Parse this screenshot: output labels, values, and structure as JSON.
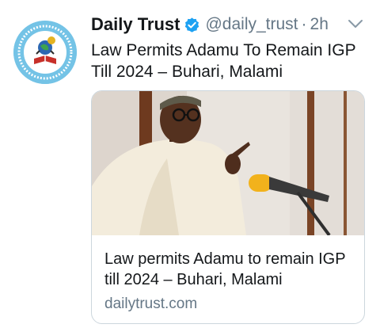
{
  "tweet": {
    "display_name": "Daily Trust",
    "handle": "@daily_trust",
    "separator": "·",
    "time": "2h",
    "text": "Law Permits Adamu To Remain IGP Till 2024 – Buhari, Malami",
    "verified_icon": "verified-badge-icon",
    "menu_icon": "chevron-down-icon",
    "avatar_icon": "daily-trust-logo"
  },
  "card": {
    "title": "Law permits Adamu to remain IGP till 2024 – Buhari, Malami",
    "domain": "dailytrust.com"
  },
  "colors": {
    "primary_text": "#14171a",
    "secondary_text": "#657786",
    "verified_blue": "#1da1f2",
    "border": "#ccd6dd"
  }
}
